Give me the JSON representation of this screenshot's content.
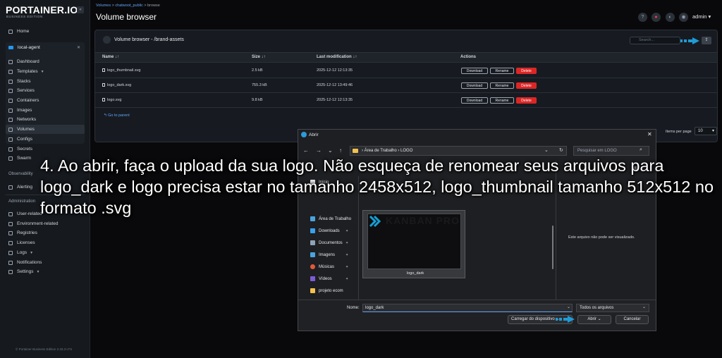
{
  "app": {
    "logo": "PORTAINER.IO",
    "edition": "BUSINESS EDITION",
    "footer": "© Portainer Business Edition 2.33.3 LTS",
    "accent": "#2496ed"
  },
  "sidebar": {
    "home": "Home",
    "environment": "local-agent",
    "env_items": [
      "Dashboard",
      "Templates",
      "Stacks",
      "Services",
      "Containers",
      "Images",
      "Networks",
      "Volumes",
      "Configs",
      "Secrets",
      "Swarm"
    ],
    "active": "Volumes",
    "observability_title": "Observability",
    "alerting": "Alerting",
    "administration_title": "Administration",
    "admin_items": [
      "User-related",
      "Environment-related",
      "Registries",
      "Licenses",
      "Logs",
      "Notifications",
      "Settings"
    ]
  },
  "header": {
    "breadcrumb": [
      "Volumes",
      "chatwoot_public",
      "browse"
    ],
    "title": "Volume browser",
    "user": "admin"
  },
  "panel": {
    "title": "Volume browser - /brand-assets",
    "search_placeholder": "Search...",
    "columns": [
      "Name ↓↑",
      "Size ↓↑",
      "Last modification ↓↑",
      "Actions"
    ],
    "rows": [
      {
        "name": "logo_thumbnail.svg",
        "size": "2.5 kB",
        "modified": "2025-12-12 12:13:35"
      },
      {
        "name": "logo_dark.svg",
        "size": "755.3 kB",
        "modified": "2025-12-12 13:49:46"
      },
      {
        "name": "logo.svg",
        "size": "9.8 kB",
        "modified": "2025-12-12 12:13:35"
      }
    ],
    "actions": {
      "download": "Download",
      "rename": "Rename",
      "delete": "Delete"
    },
    "go_parent": "Go to parent",
    "items_per_page_label": "Items per page",
    "items_per_page": "10"
  },
  "dialog": {
    "title": "Abrir",
    "path": [
      "Área de Trabalho",
      "LOGO"
    ],
    "search_placeholder": "Pesquisar em LOGO",
    "tree": [
      "Início",
      "Área de Trabalho",
      "Downloads",
      "Documentos",
      "Imagens",
      "Músicas",
      "Vídeos",
      "projeto ecom"
    ],
    "tree_colors": [
      "#e5e7eb",
      "#4aa3df",
      "#39a0ed",
      "#8fa3b8",
      "#4aa3df",
      "#e05a3a",
      "#7c5cd6",
      "#f2c14e"
    ],
    "file_label": "logo_dark",
    "thumb_brand": "KANBAN PRO",
    "preview_text": "Este arquivo não pode ser visualizado.",
    "filename_label": "Nome:",
    "filename": "logo_dark",
    "filetype": "Todos os arquivos",
    "btn_device": "Carregar do dispositivo",
    "btn_open": "Abrir",
    "btn_cancel": "Cancelar"
  },
  "caption": "4. Ao abrir, faça o upload da sua logo. Não esqueça de renomear seus arquivos para logo_dark e logo precisa estar no tamanho 2458x512, logo_thumbnail tamanho 512x512 no formato .svg"
}
